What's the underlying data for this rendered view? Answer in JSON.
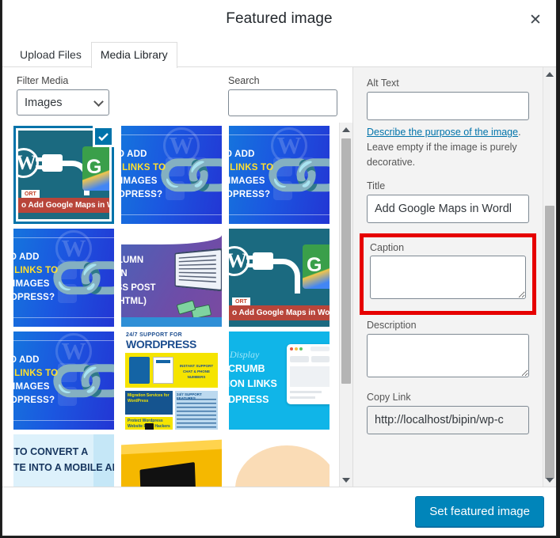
{
  "modal": {
    "title": "Featured image",
    "close_label": "✕"
  },
  "tabs": [
    {
      "label": "Upload Files",
      "active": false
    },
    {
      "label": "Media Library",
      "active": true
    }
  ],
  "toolbar": {
    "filter_label": "Filter Media",
    "filter_value": "Images",
    "filter_options": [
      "Images"
    ],
    "search_label": "Search",
    "search_value": "",
    "search_placeholder": ""
  },
  "grid": {
    "items": [
      {
        "art": "teal",
        "selected": true,
        "banner_text": "o Add Google Maps in WordP",
        "sticker_text": "ORT",
        "maps_letter": "G",
        "wp_letter": "W"
      },
      {
        "art": "blue",
        "selected": false,
        "line1": "TO ADD",
        "line2": "M LINKS TO",
        "line3": "Y IMAGES",
        "line4": "RDPRESS?",
        "wp_letter": "W"
      },
      {
        "art": "blue",
        "selected": false,
        "line1": "TO ADD",
        "line2": "M LINKS TO",
        "line3": "Y IMAGES",
        "line4": "RDPRESS?",
        "wp_letter": "W"
      },
      {
        "art": "blue",
        "selected": false,
        "line1": "TO ADD",
        "line2": "M LINKS TO",
        "line3": "Y IMAGES",
        "line4": "RDPRESS?",
        "wp_letter": "W"
      },
      {
        "art": "purple",
        "selected": false,
        "line1": "OLUMN",
        "line2": "T IN",
        "line3": "ESS POST",
        "line4": "T HTML)"
      },
      {
        "art": "teal",
        "selected": false,
        "banner_text": "o Add Google Maps in WordP",
        "sticker_text": "ORT",
        "maps_letter": "G",
        "wp_letter": "W"
      },
      {
        "art": "blue",
        "selected": false,
        "line1": "TO ADD",
        "line2": "M LINKS TO",
        "line3": "Y IMAGES",
        "line4": "RDPRESS?",
        "wp_letter": "W"
      },
      {
        "art": "infographic",
        "selected": false,
        "heading_small": "24/7 SUPPORT FOR",
        "heading_big": "WORDPRESS",
        "yellow_text": "INSTANT SUPPORT CHAT & PHONE NUMBERS",
        "blue_box_text": "Migration Services for WordPress",
        "yellow_box_text": "Protect Wordpress Website From Hackers",
        "right_col_title": "24/7 SUPPORT FEATURES"
      },
      {
        "art": "cyan",
        "selected": false,
        "script_line": "o Display",
        "line1": "DCRUMB",
        "line2": "TION LINKS",
        "line3": "RDPRESS"
      },
      {
        "art": "lightblue",
        "selected": false,
        "line1": "N TO CONVERT A",
        "line2": "SITE INTO A MOBILE APP"
      },
      {
        "art": "yellow",
        "selected": false
      },
      {
        "art": "peach",
        "selected": false
      }
    ]
  },
  "sidebar": {
    "alt_text": {
      "label": "Alt Text",
      "value": ""
    },
    "helper": {
      "link_text": "Describe the purpose of the image",
      "after_link": ".",
      "rest": "Leave empty if the image is purely decorative."
    },
    "title": {
      "label": "Title",
      "value": "Add Google Maps in Wordl"
    },
    "caption": {
      "label": "Caption",
      "value": "",
      "highlight_color": "#e60000"
    },
    "description": {
      "label": "Description",
      "value": ""
    },
    "copy_link": {
      "label": "Copy Link",
      "value": "http://localhost/bipin/wp-c"
    }
  },
  "footer": {
    "primary_button": "Set featured image",
    "primary_color": "#0085ba"
  }
}
